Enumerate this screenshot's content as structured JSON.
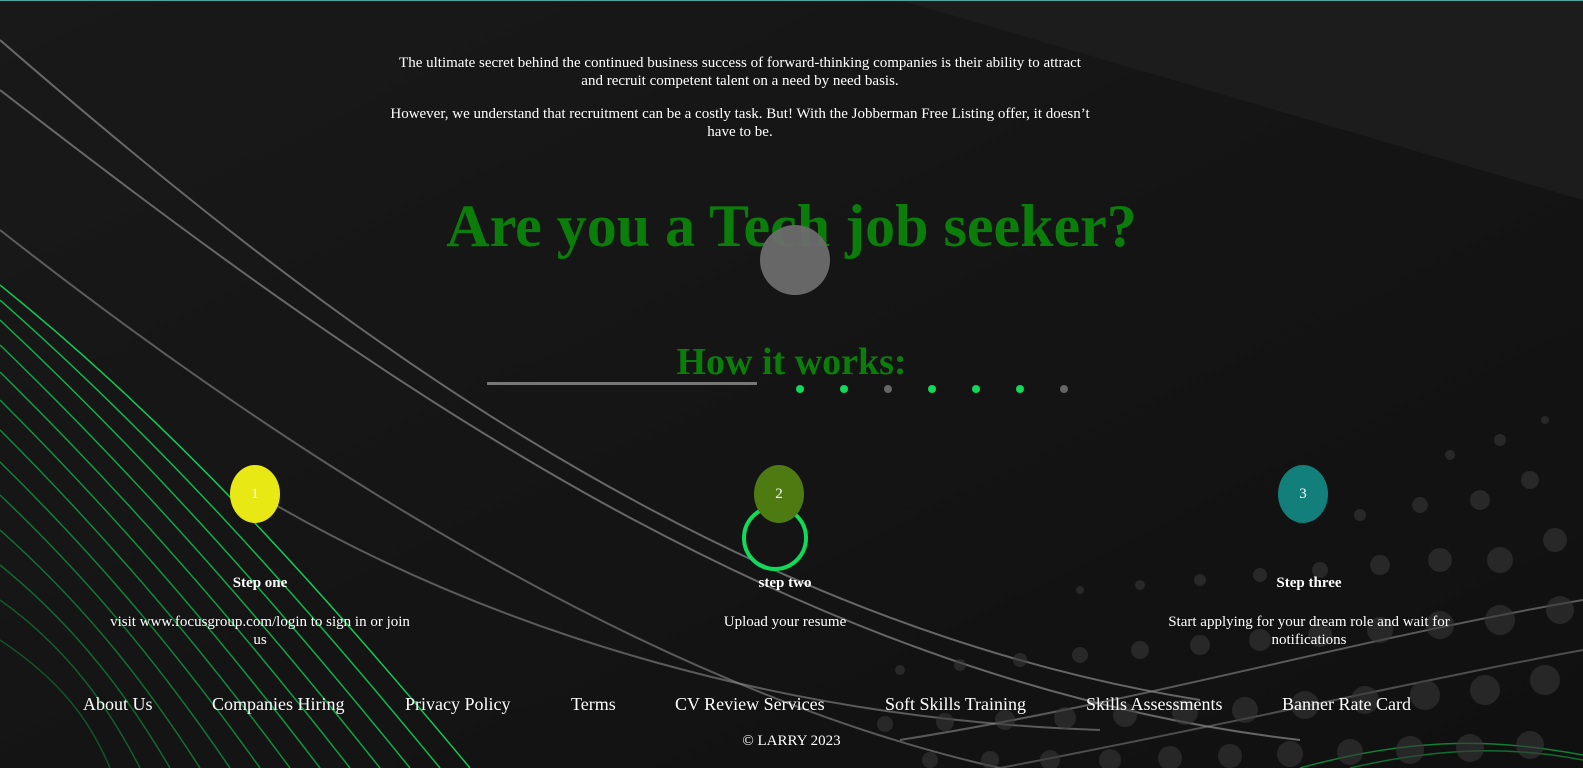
{
  "intro": {
    "paragraph1": "The ultimate secret behind the continued business success of forward-thinking companies is their ability to attract and recruit competent talent on a need by need basis.",
    "paragraph2": "However, we understand that recruitment can be a costly task. But! With the Jobberman Free Listing offer, it doesn’t have to be."
  },
  "headline": "Are you a Tech job seeker?",
  "how_it_works": {
    "title": "How it works:",
    "carousel_dots": [
      "active",
      "active",
      "inactive",
      "active",
      "active",
      "active",
      "inactive"
    ]
  },
  "steps": [
    {
      "number": "1",
      "title": "Step one",
      "text": "visit www.focusgroup.com/login to sign in or join us",
      "color": "#e8e815"
    },
    {
      "number": "2",
      "title": "step two",
      "text": "Upload your resume",
      "color": "#4e7a12"
    },
    {
      "number": "3",
      "title": "Step three",
      "text": "Start applying for your dream role and wait for notifications",
      "color": "#137f7a"
    }
  ],
  "footer": {
    "links": [
      "About Us",
      "Companies Hiring",
      "Privacy Policy",
      "Terms",
      "CV Review Services",
      "Soft Skills Training",
      "Skills Assessments",
      "Banner Rate Card"
    ],
    "copyright": "© LARRY 2023"
  },
  "colors": {
    "background": "#141414",
    "heading_green": "#0a7d0a",
    "accent_green": "#11d95a"
  }
}
